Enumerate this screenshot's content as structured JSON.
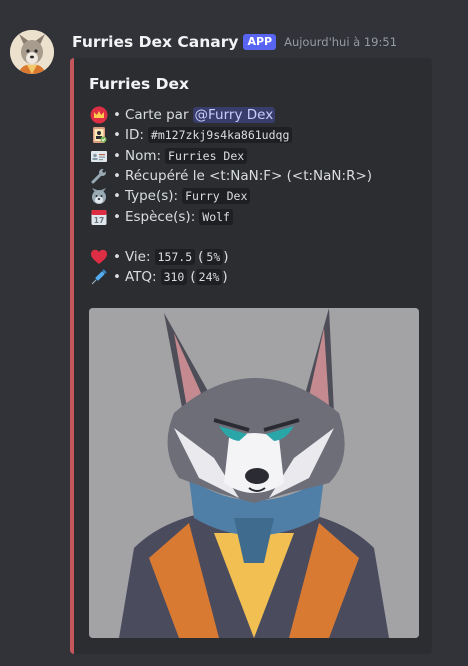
{
  "message": {
    "author": "Furries Dex Canary",
    "tag": "APP",
    "timestamp": "Aujourd'hui à 19:51"
  },
  "embed": {
    "accent_color": "#c4575c",
    "title": "Furries Dex",
    "fields": [
      {
        "icon": "crown-icon",
        "prefix": "Carte par",
        "mention": "@Furry Dex"
      },
      {
        "icon": "id-badge-icon",
        "label": "ID:",
        "code": "#m127zkj9s4ka861udqg"
      },
      {
        "icon": "id-card-icon",
        "label": "Nom:",
        "code": "Furries Dex"
      },
      {
        "icon": "wrench-icon",
        "text": "Récupéré le <t:NaN:F> (<t:NaN:R>)"
      },
      {
        "icon": "wolf-icon",
        "label": "Type(s):",
        "code": "Furry Dex"
      },
      {
        "icon": "calendar-icon",
        "label": "Espèce(s):",
        "code": "Wolf"
      },
      {
        "icon": "heart-icon",
        "label": "Vie:",
        "code": "157.5",
        "code2": "5%"
      },
      {
        "icon": "syringe-icon",
        "label": "ATQ:",
        "code": "310",
        "code2": "24%"
      }
    ],
    "calendar_day": "17"
  }
}
